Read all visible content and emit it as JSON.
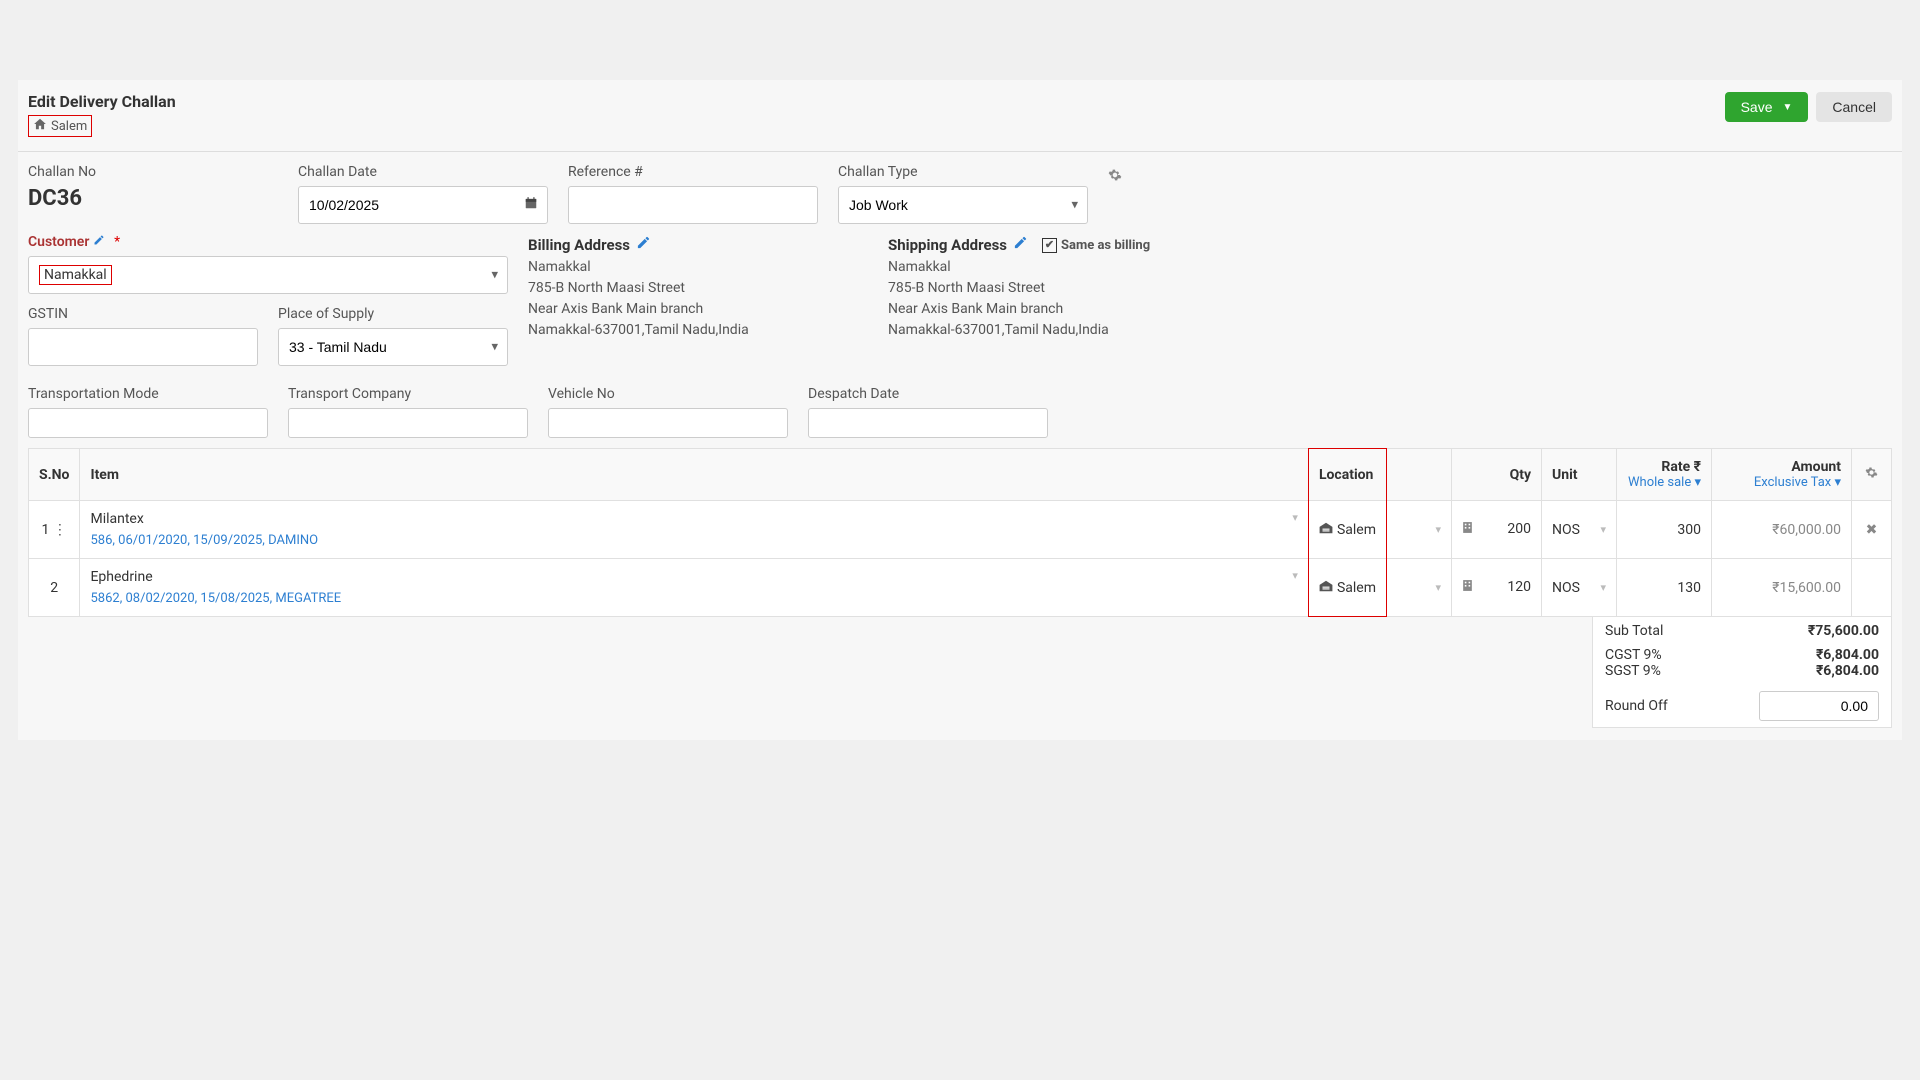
{
  "header": {
    "title": "Edit Delivery Challan",
    "branch": "Salem",
    "save_label": "Save",
    "cancel_label": "Cancel"
  },
  "fields": {
    "challan_no_label": "Challan No",
    "challan_no_value": "DC36",
    "challan_date_label": "Challan Date",
    "challan_date_value": "10/02/2025",
    "reference_label": "Reference #",
    "reference_value": "",
    "challan_type_label": "Challan Type",
    "challan_type_value": "Job Work",
    "customer_label": "Customer",
    "customer_value": "Namakkal",
    "gstin_label": "GSTIN",
    "gstin_value": "",
    "place_of_supply_label": "Place of Supply",
    "place_of_supply_value": "33 - Tamil Nadu",
    "transport_mode_label": "Transportation Mode",
    "transport_mode_value": "",
    "transport_company_label": "Transport Company",
    "transport_company_value": "",
    "vehicle_no_label": "Vehicle No",
    "vehicle_no_value": "",
    "despatch_date_label": "Despatch Date",
    "despatch_date_value": ""
  },
  "billing": {
    "heading": "Billing Address",
    "name": "Namakkal",
    "line1": "785-B North Maasi Street",
    "line2": "Near Axis Bank Main branch",
    "line3": "Namakkal-637001,Tamil Nadu,India"
  },
  "shipping": {
    "heading": "Shipping Address",
    "same_label": "Same as billing",
    "name": "Namakkal",
    "line1": "785-B North Maasi Street",
    "line2": "Near Axis Bank Main branch",
    "line3": "Namakkal-637001,Tamil Nadu,India"
  },
  "table": {
    "headers": {
      "sno": "S.No",
      "item": "Item",
      "location": "Location",
      "qty": "Qty",
      "unit": "Unit",
      "rate": "Rate ₹",
      "rate_sub": "Whole sale",
      "amount": "Amount",
      "amount_sub": "Exclusive Tax"
    },
    "rows": [
      {
        "sno": "1",
        "item": "Milantex",
        "meta": "586, 06/01/2020, 15/09/2025, DAMINO",
        "location": "Salem",
        "qty": "200",
        "unit": "NOS",
        "rate": "300",
        "amount": "₹60,000.00"
      },
      {
        "sno": "2",
        "item": "Ephedrine",
        "meta": "5862, 08/02/2020, 15/08/2025, MEGATREE",
        "location": "Salem",
        "qty": "120",
        "unit": "NOS",
        "rate": "130",
        "amount": "₹15,600.00"
      }
    ]
  },
  "totals": {
    "subtotal_label": "Sub Total",
    "subtotal_value": "₹75,600.00",
    "cgst_label": "CGST 9%",
    "cgst_value": "₹6,804.00",
    "sgst_label": "SGST 9%",
    "sgst_value": "₹6,804.00",
    "roundoff_label": "Round Off",
    "roundoff_value": "0.00"
  }
}
